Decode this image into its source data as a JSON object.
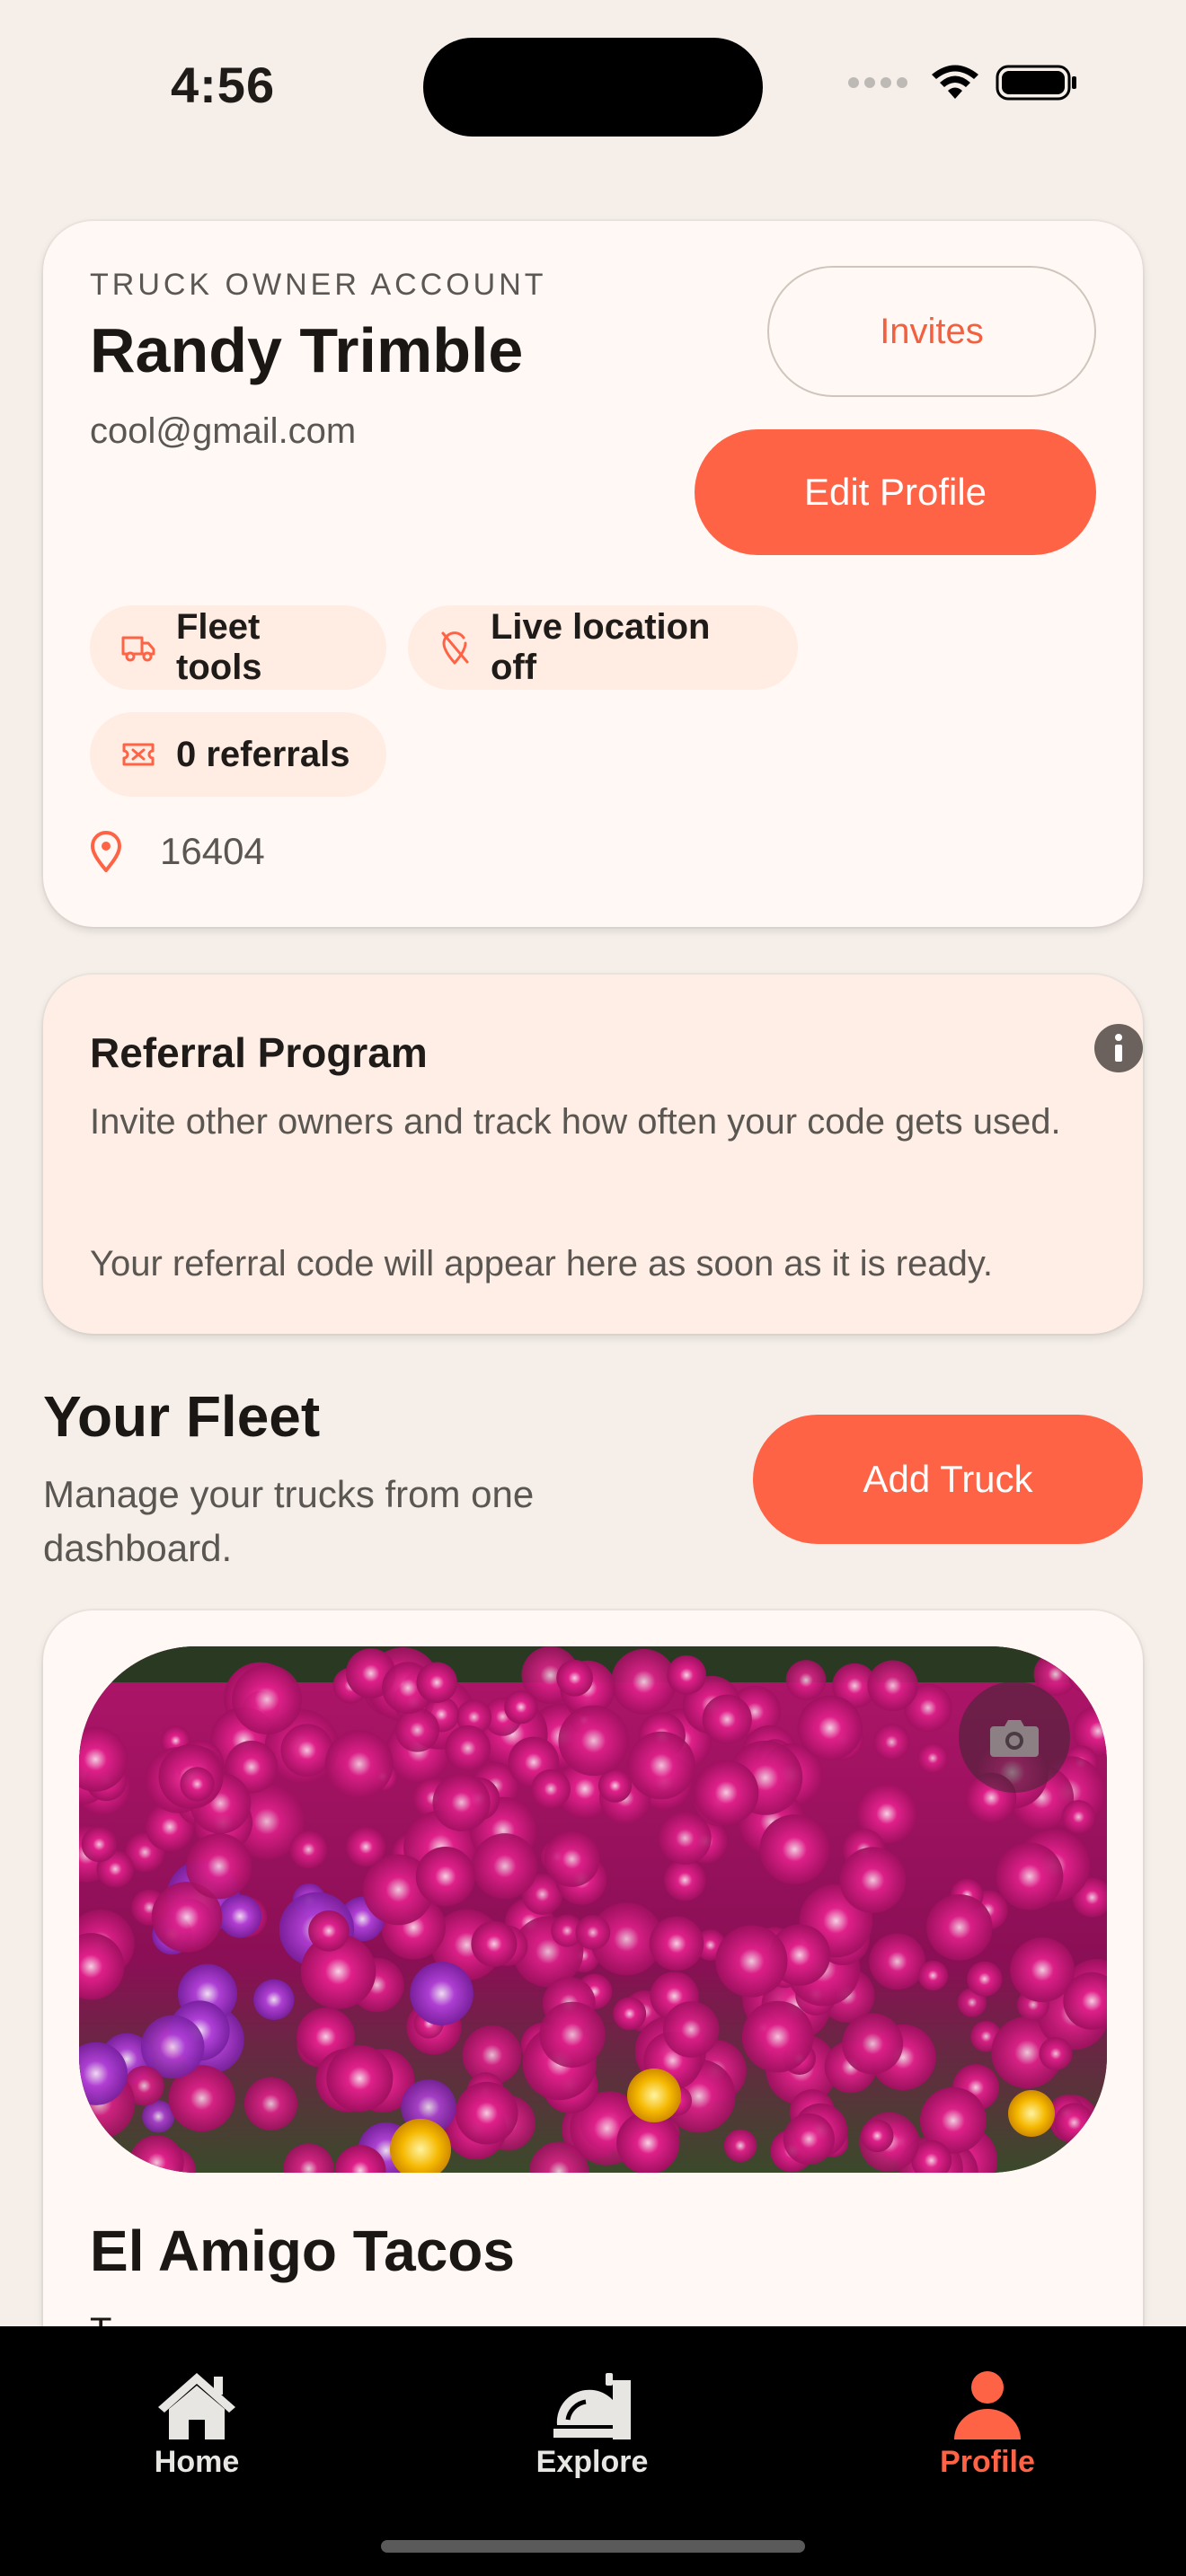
{
  "status_bar": {
    "time": "4:56"
  },
  "profile": {
    "eyebrow": "TRUCK OWNER ACCOUNT",
    "name": "Randy Trimble",
    "email": "cool@gmail.com",
    "invites_label": "Invites",
    "edit_label": "Edit Profile",
    "chips": {
      "fleet": "Fleet tools",
      "location": "Live location off",
      "referrals": "0 referrals"
    },
    "zip": "16404"
  },
  "referral": {
    "title": "Referral Program",
    "description": "Invite other owners and track how often your code gets used.",
    "note": "Your referral code will appear here as soon as it is ready."
  },
  "fleet": {
    "title": "Your Fleet",
    "subtitle": "Manage your trucks from one dashboard.",
    "add_label": "Add Truck",
    "trucks": [
      {
        "name": "El Amigo Tacos",
        "line": "T"
      }
    ]
  },
  "tabbar": {
    "home": "Home",
    "explore": "Explore",
    "profile": "Profile",
    "active": "profile"
  },
  "colors": {
    "accent": "#FF6346",
    "background": "#F6EFE9",
    "card": "#FFF8F4",
    "chip": "#FFEDE3"
  },
  "icons": {
    "fleet_chip": "truck-icon",
    "location_chip": "location-off-icon",
    "referral_chip": "ticket-icon",
    "zip": "map-pin-icon",
    "info": "info-icon",
    "camera": "camera-icon"
  }
}
